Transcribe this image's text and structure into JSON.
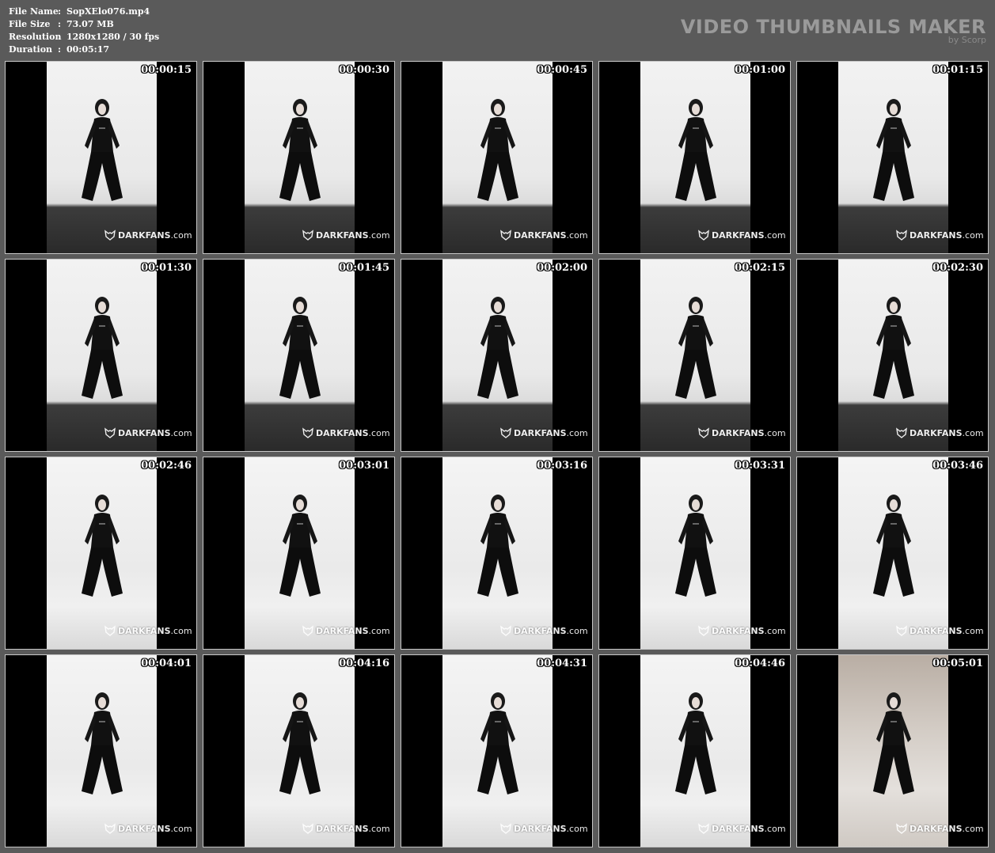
{
  "meta": {
    "file_name_label": "File Name",
    "file_name": "SopXElo076.mp4",
    "file_size_label": "File Size",
    "file_size": "73.07 MB",
    "resolution_label": "Resolution",
    "resolution": "1280x1280 / 30 fps",
    "duration_label": "Duration",
    "duration": "00:05:17",
    "separator": ":"
  },
  "brand": {
    "title": "VIDEO THUMBNAILS MAKER",
    "subtitle": "by Scorp"
  },
  "watermark": {
    "bold_part": "DARKFANS",
    "suffix": ".com"
  },
  "thumbnails": [
    {
      "timestamp": "00:00:15"
    },
    {
      "timestamp": "00:00:30"
    },
    {
      "timestamp": "00:00:45"
    },
    {
      "timestamp": "00:01:00"
    },
    {
      "timestamp": "00:01:15"
    },
    {
      "timestamp": "00:01:30"
    },
    {
      "timestamp": "00:01:45"
    },
    {
      "timestamp": "00:02:00"
    },
    {
      "timestamp": "00:02:15"
    },
    {
      "timestamp": "00:02:30"
    },
    {
      "timestamp": "00:02:46"
    },
    {
      "timestamp": "00:03:01"
    },
    {
      "timestamp": "00:03:16"
    },
    {
      "timestamp": "00:03:31"
    },
    {
      "timestamp": "00:03:46"
    },
    {
      "timestamp": "00:04:01"
    },
    {
      "timestamp": "00:04:16"
    },
    {
      "timestamp": "00:04:31"
    },
    {
      "timestamp": "00:04:46"
    },
    {
      "timestamp": "00:05:01"
    }
  ],
  "colors": {
    "background": "#5a5a5a",
    "thumb_border": "#c8c8c8",
    "text": "#ffffff",
    "brand": "#9a9a9a"
  }
}
